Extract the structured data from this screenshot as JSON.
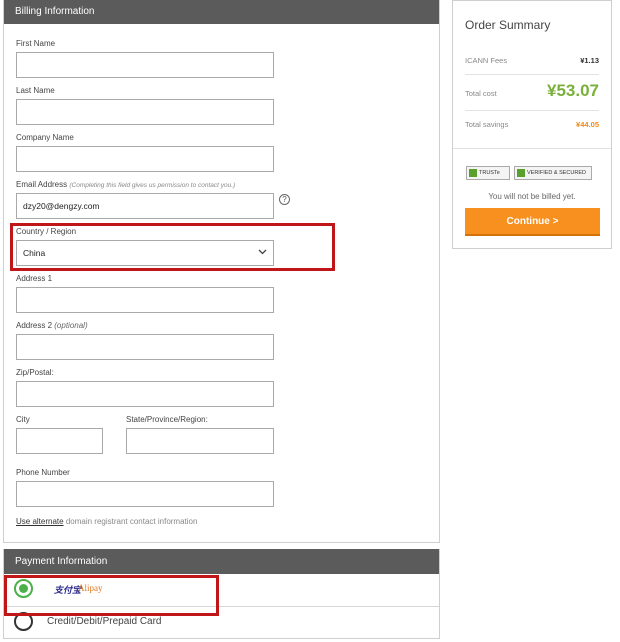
{
  "billing": {
    "title": "Billing Information",
    "first_name_label": "First Name",
    "last_name_label": "Last Name",
    "company_label": "Company Name",
    "email_label": "Email Address",
    "email_hint": "(Completing this field gives us permission to contact you.)",
    "email_value": "dzy20@dengzy.com",
    "help_glyph": "?",
    "country_label": "Country / Region",
    "country_value": "China",
    "address1_label": "Address 1",
    "address2_label": "Address 2",
    "address2_optional": "(optional)",
    "zip_label": "Zip/Postal:",
    "city_label": "City",
    "state_label": "State/Province/Region:",
    "phone_label": "Phone Number",
    "alt_link": "Use alternate",
    "alt_text": " domain registrant contact information"
  },
  "payment": {
    "title": "Payment Information",
    "alipay_cn": "支付宝",
    "alipay_en": "Alipay",
    "card_label": "Credit/Debit/Prepaid Card"
  },
  "summary": {
    "title": "Order Summary",
    "icann_label": "ICANN Fees",
    "icann_value": "¥1.13",
    "total_label": "Total cost",
    "total_value": "¥53.07",
    "savings_label": "Total savings",
    "savings_value": "¥44.05",
    "truste": "TRUSTe",
    "verified": "VERIFIED & SECURED",
    "not_billed": "You will not be billed yet.",
    "continue": "Continue >"
  },
  "colors": {
    "header_bg": "#5b5b5b",
    "highlight": "#c0161a",
    "total_green": "#7ab03a",
    "savings_orange": "#f08a18",
    "continue_orange": "#f7901e",
    "radio_green": "#4cb04a"
  }
}
